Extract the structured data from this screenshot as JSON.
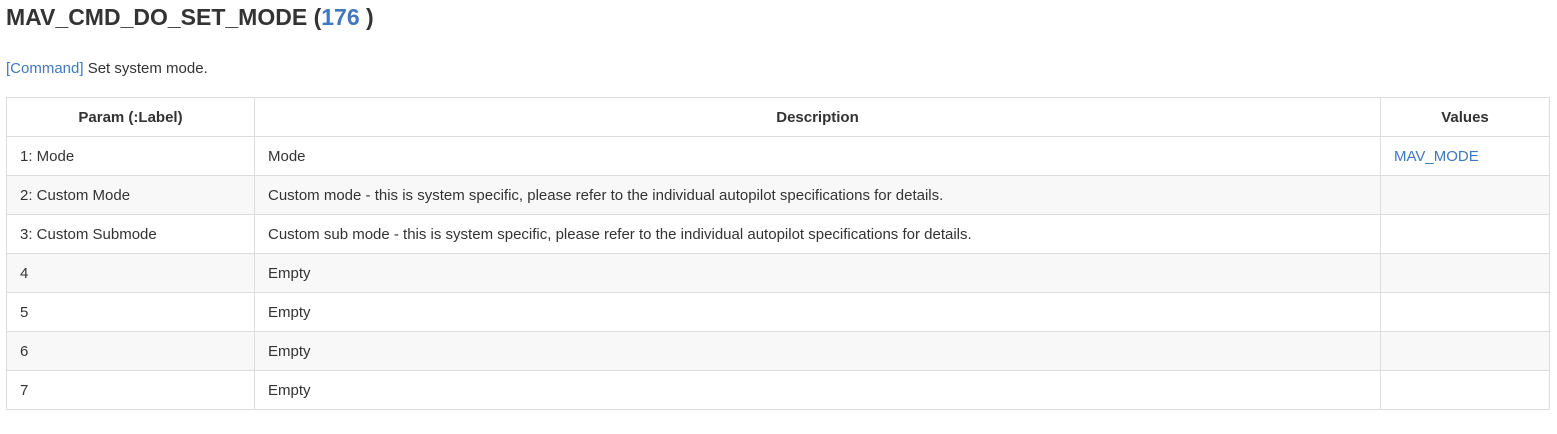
{
  "heading": {
    "name": "MAV_CMD_DO_SET_MODE",
    "open_paren": " (",
    "id": "176",
    "close_paren": " )"
  },
  "summary": {
    "tag": "[Command]",
    "text": " Set system mode."
  },
  "table": {
    "headers": [
      "Param (:Label)",
      "Description",
      "Values"
    ],
    "rows": [
      {
        "param": "1: Mode",
        "description": "Mode",
        "values": "MAV_MODE"
      },
      {
        "param": "2: Custom Mode",
        "description": "Custom mode - this is system specific, please refer to the individual autopilot specifications for details.",
        "values": ""
      },
      {
        "param": "3: Custom Submode",
        "description": "Custom sub mode - this is system specific, please refer to the individual autopilot specifications for details.",
        "values": ""
      },
      {
        "param": "4",
        "description": "Empty",
        "values": ""
      },
      {
        "param": "5",
        "description": "Empty",
        "values": ""
      },
      {
        "param": "6",
        "description": "Empty",
        "values": ""
      },
      {
        "param": "7",
        "description": "Empty",
        "values": ""
      }
    ]
  },
  "colors": {
    "link": "#4078c0",
    "text": "#333333",
    "border": "#dddddd",
    "stripe": "#f8f8f8"
  }
}
